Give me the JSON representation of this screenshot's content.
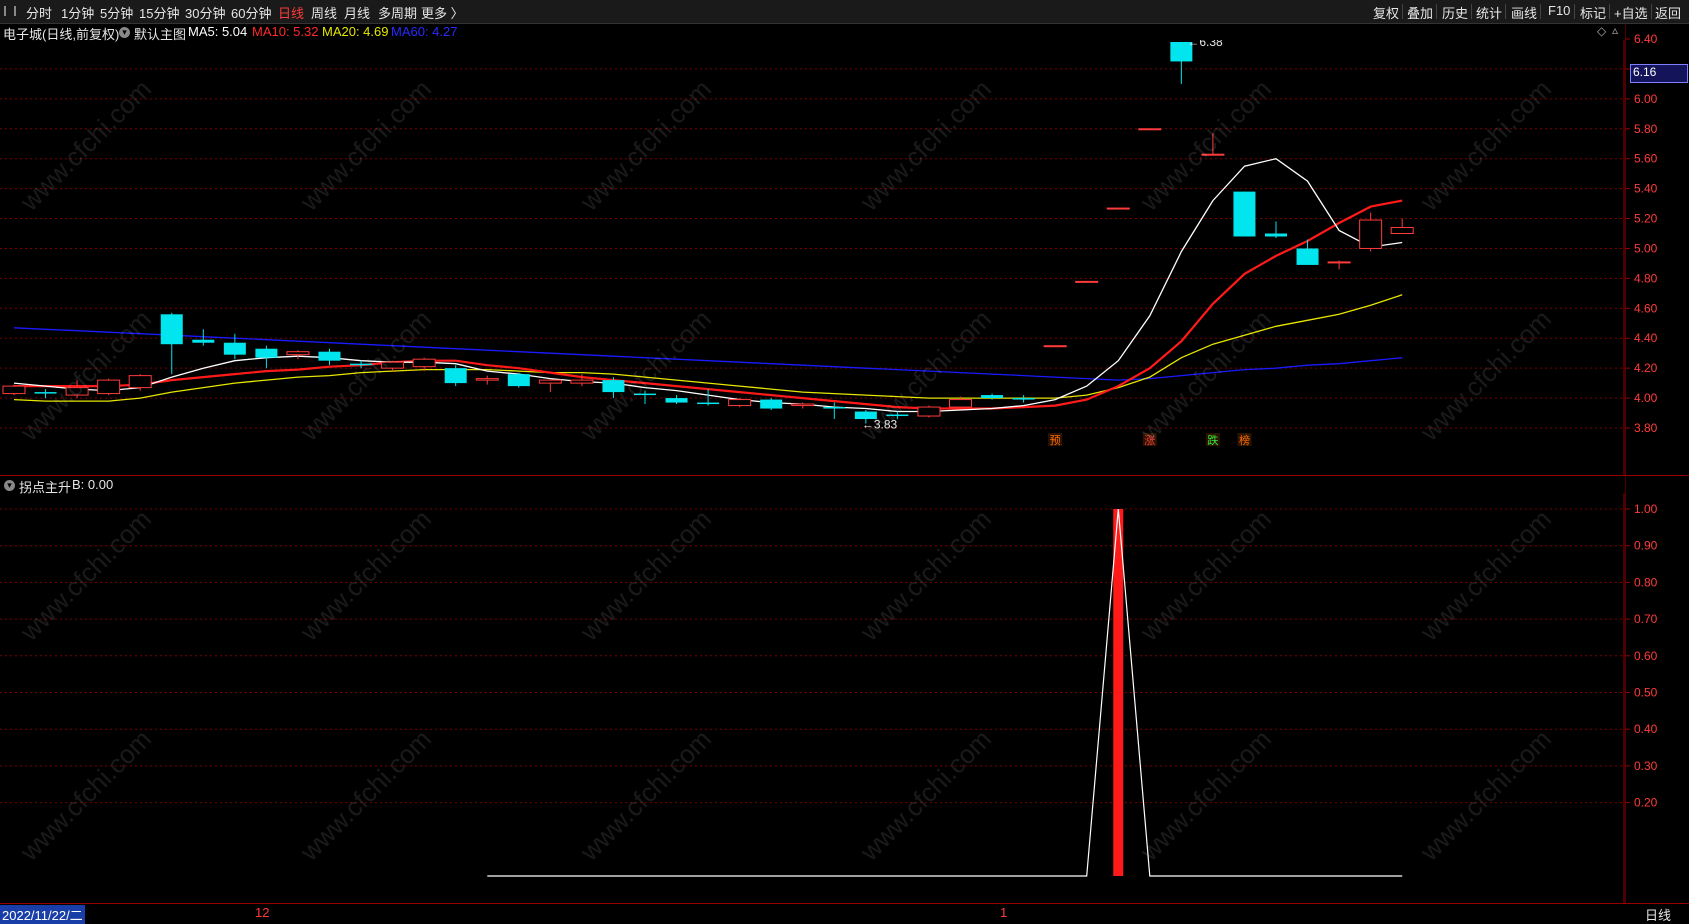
{
  "toolbar": {
    "timeframes": [
      "分时",
      "1分钟",
      "5分钟",
      "15分钟",
      "30分钟",
      "60分钟",
      "日线",
      "周线",
      "月线",
      "多周期",
      "更多 〉"
    ],
    "active_timeframe": "日线",
    "right_buttons": [
      "复权",
      "叠加",
      "历史",
      "统计",
      "画线",
      "F10",
      "标记",
      "+自选",
      "返回"
    ]
  },
  "main_panel": {
    "stock_title": "电子城(日线,前复权)",
    "template_label": "默认主图",
    "ma5": "MA5: 5.04",
    "ma10": "MA10: 5.32",
    "ma20": "MA20: 4.69",
    "ma60": "MA60: 4.27",
    "price_tag": "6.16",
    "high_label": "6.38",
    "low_label": "3.83",
    "y_ticks": [
      "6.40",
      "6.20",
      "6.00",
      "5.80",
      "5.60",
      "5.40",
      "5.20",
      "5.00",
      "4.80",
      "4.60",
      "4.40",
      "4.20",
      "4.00",
      "3.80"
    ],
    "markers": [
      "预",
      "涨",
      "跌",
      "榜"
    ]
  },
  "indicator_panel": {
    "title": "拐点主升",
    "value": "B: 0.00",
    "y_ticks": [
      "1.00",
      "0.90",
      "0.80",
      "0.70",
      "0.60",
      "0.50",
      "0.40",
      "0.30",
      "0.20"
    ]
  },
  "bottom": {
    "date": "2022/11/22/二",
    "month_12": "12",
    "month_1": "1",
    "period": "日线"
  },
  "watermark": "www.cfchi.com",
  "colors": {
    "up": "#ff3b3b",
    "down": "#00e5ee",
    "ma5": "#ffffff",
    "ma10": "#ff1a1a",
    "ma20": "#e6e600",
    "ma60": "#1a1aff",
    "grid": "#7a0000"
  },
  "candles": [
    {
      "o": 4.03,
      "h": 4.09,
      "l": 4.02,
      "c": 4.08
    },
    {
      "o": 4.04,
      "h": 4.06,
      "l": 4.0,
      "c": 4.03
    },
    {
      "o": 4.02,
      "h": 4.12,
      "l": 4.0,
      "c": 4.07
    },
    {
      "o": 4.03,
      "h": 4.13,
      "l": 4.02,
      "c": 4.12
    },
    {
      "o": 4.07,
      "h": 4.16,
      "l": 4.05,
      "c": 4.15
    },
    {
      "o": 4.56,
      "h": 4.57,
      "l": 4.16,
      "c": 4.36
    },
    {
      "o": 4.39,
      "h": 4.46,
      "l": 4.35,
      "c": 4.37
    },
    {
      "o": 4.37,
      "h": 4.43,
      "l": 4.26,
      "c": 4.29
    },
    {
      "o": 4.33,
      "h": 4.35,
      "l": 4.2,
      "c": 4.27
    },
    {
      "o": 4.29,
      "h": 4.32,
      "l": 4.26,
      "c": 4.31
    },
    {
      "o": 4.31,
      "h": 4.33,
      "l": 4.22,
      "c": 4.25
    },
    {
      "o": 4.23,
      "h": 4.25,
      "l": 4.2,
      "c": 4.22
    },
    {
      "o": 4.2,
      "h": 4.25,
      "l": 4.18,
      "c": 4.24
    },
    {
      "o": 4.21,
      "h": 4.27,
      "l": 4.18,
      "c": 4.26
    },
    {
      "o": 4.2,
      "h": 4.22,
      "l": 4.08,
      "c": 4.1
    },
    {
      "o": 4.12,
      "h": 4.15,
      "l": 4.09,
      "c": 4.13
    },
    {
      "o": 4.16,
      "h": 4.17,
      "l": 4.07,
      "c": 4.08
    },
    {
      "o": 4.1,
      "h": 4.12,
      "l": 4.04,
      "c": 4.12
    },
    {
      "o": 4.1,
      "h": 4.16,
      "l": 4.08,
      "c": 4.12
    },
    {
      "o": 4.12,
      "h": 4.14,
      "l": 4.0,
      "c": 4.04
    },
    {
      "o": 4.03,
      "h": 4.05,
      "l": 3.96,
      "c": 4.02
    },
    {
      "o": 4.0,
      "h": 4.02,
      "l": 3.96,
      "c": 3.97
    },
    {
      "o": 3.97,
      "h": 4.06,
      "l": 3.95,
      "c": 3.96
    },
    {
      "o": 3.95,
      "h": 4.0,
      "l": 3.94,
      "c": 3.99
    },
    {
      "o": 3.99,
      "h": 4.0,
      "l": 3.92,
      "c": 3.93
    },
    {
      "o": 3.95,
      "h": 3.97,
      "l": 3.93,
      "c": 3.96
    },
    {
      "o": 3.94,
      "h": 3.97,
      "l": 3.86,
      "c": 3.93
    },
    {
      "o": 3.91,
      "h": 3.92,
      "l": 3.83,
      "c": 3.86
    },
    {
      "o": 3.89,
      "h": 3.91,
      "l": 3.86,
      "c": 3.88
    },
    {
      "o": 3.88,
      "h": 3.95,
      "l": 3.87,
      "c": 3.94
    },
    {
      "o": 3.94,
      "h": 4.01,
      "l": 3.93,
      "c": 3.99
    },
    {
      "o": 4.02,
      "h": 4.03,
      "l": 3.99,
      "c": 4.0
    },
    {
      "o": 4.0,
      "h": 4.02,
      "l": 3.97,
      "c": 3.99
    },
    {
      "o": 4.35,
      "h": 4.35,
      "l": 4.35,
      "c": 4.35
    },
    {
      "o": 4.78,
      "h": 4.78,
      "l": 4.78,
      "c": 4.78
    },
    {
      "o": 5.27,
      "h": 5.27,
      "l": 5.27,
      "c": 5.27
    },
    {
      "o": 5.8,
      "h": 5.8,
      "l": 5.8,
      "c": 5.8
    },
    {
      "o": 6.38,
      "h": 6.38,
      "l": 6.1,
      "c": 6.25
    },
    {
      "o": 5.63,
      "h": 5.77,
      "l": 5.62,
      "c": 5.63
    },
    {
      "o": 5.38,
      "h": 5.38,
      "l": 5.08,
      "c": 5.08
    },
    {
      "o": 5.1,
      "h": 5.18,
      "l": 5.07,
      "c": 5.08
    },
    {
      "o": 5.0,
      "h": 5.06,
      "l": 4.89,
      "c": 4.89
    },
    {
      "o": 4.91,
      "h": 4.92,
      "l": 4.86,
      "c": 4.91
    },
    {
      "o": 5.0,
      "h": 5.24,
      "l": 4.98,
      "c": 5.19
    },
    {
      "o": 5.1,
      "h": 5.2,
      "l": 5.1,
      "c": 5.14
    }
  ],
  "ma_lines": {
    "ma5": [
      4.1,
      4.08,
      4.06,
      4.05,
      4.07,
      4.14,
      4.2,
      4.25,
      4.27,
      4.28,
      4.27,
      4.25,
      4.24,
      4.24,
      4.23,
      4.18,
      4.16,
      4.13,
      4.11,
      4.1,
      4.07,
      4.05,
      4.02,
      3.99,
      3.97,
      3.96,
      3.94,
      3.93,
      3.91,
      3.91,
      3.92,
      3.93,
      3.95,
      3.99,
      4.08,
      4.25,
      4.55,
      4.98,
      5.32,
      5.55,
      5.6,
      5.45,
      5.12,
      5.01,
      5.04
    ],
    "ma10": [
      4.08,
      4.08,
      4.08,
      4.08,
      4.09,
      4.12,
      4.14,
      4.16,
      4.18,
      4.19,
      4.21,
      4.22,
      4.24,
      4.25,
      4.25,
      4.22,
      4.2,
      4.17,
      4.14,
      4.12,
      4.1,
      4.08,
      4.06,
      4.04,
      4.02,
      4.0,
      3.98,
      3.96,
      3.94,
      3.93,
      3.93,
      3.93,
      3.94,
      3.95,
      3.99,
      4.08,
      4.2,
      4.38,
      4.63,
      4.83,
      4.95,
      5.05,
      5.17,
      5.28,
      5.32
    ],
    "ma20": [
      3.99,
      3.98,
      3.98,
      3.98,
      4.0,
      4.04,
      4.07,
      4.1,
      4.12,
      4.14,
      4.15,
      4.17,
      4.18,
      4.19,
      4.19,
      4.19,
      4.18,
      4.17,
      4.17,
      4.16,
      4.14,
      4.12,
      4.1,
      4.08,
      4.06,
      4.04,
      4.03,
      4.02,
      4.01,
      4.0,
      4.0,
      4.0,
      4.0,
      4.0,
      4.02,
      4.07,
      4.14,
      4.27,
      4.36,
      4.42,
      4.48,
      4.52,
      4.56,
      4.62,
      4.69
    ],
    "ma60": [
      4.47,
      4.46,
      4.45,
      4.44,
      4.43,
      4.42,
      4.41,
      4.4,
      4.39,
      4.38,
      4.37,
      4.36,
      4.35,
      4.34,
      4.33,
      4.32,
      4.31,
      4.3,
      4.29,
      4.28,
      4.27,
      4.26,
      4.25,
      4.24,
      4.23,
      4.22,
      4.21,
      4.2,
      4.19,
      4.18,
      4.17,
      4.16,
      4.15,
      4.14,
      4.13,
      4.12,
      4.13,
      4.15,
      4.17,
      4.19,
      4.2,
      4.22,
      4.23,
      4.25,
      4.27
    ]
  },
  "indicator": {
    "line": [
      0,
      0,
      0,
      0,
      0,
      0,
      0,
      0,
      0,
      0,
      0,
      0,
      0,
      0,
      0,
      0,
      0,
      0,
      0,
      0,
      0,
      0,
      0,
      0,
      0,
      0,
      0,
      0,
      0,
      0,
      0,
      0,
      0,
      0,
      0,
      1,
      0,
      0,
      0,
      0,
      0,
      0,
      0,
      0
    ],
    "bar_index": 35,
    "bar_value": 1.0
  }
}
